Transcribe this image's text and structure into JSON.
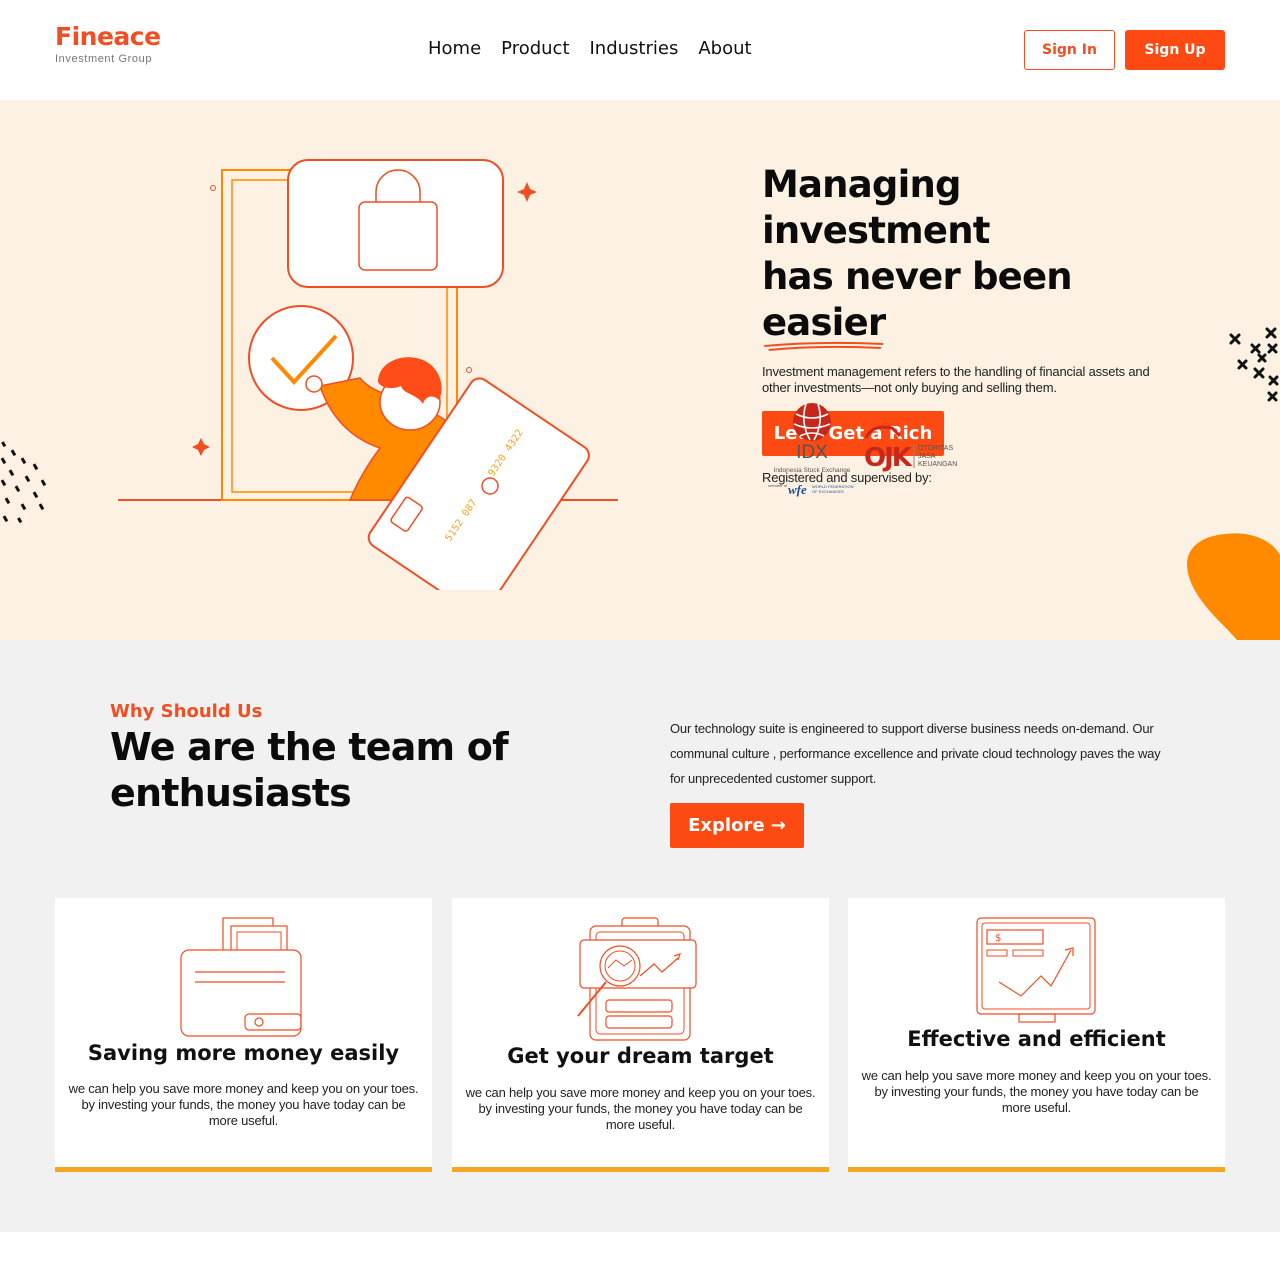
{
  "header": {
    "logo_name": "Fineace",
    "logo_sub": "Investment Group",
    "nav": [
      "Home",
      "Product",
      "Industries",
      "About"
    ],
    "signin_label": "Sign In",
    "signup_label": "Sign Up"
  },
  "hero": {
    "title_line1": "Managing investment",
    "title_line2_prefix": "has never been ",
    "title_highlight": "easier",
    "description": "Investment management refers to the handling of financial assets and other investments—not only buying and selling them.",
    "cta_label": "Let's Get a Rich",
    "registered_label": "Registered and supervised by:",
    "card_number_1": "5152 087",
    "card_number_2": "9320 4322",
    "partners": {
      "idx_name": "IDX",
      "idx_sub": "Indonesia Stock Exchange",
      "wfe_member": "member of",
      "wfe_name": "wfe",
      "wfe_sub1": "WORLD FEDERATION",
      "wfe_sub2": "OF EXCHANGES",
      "ojk_name": "OJK",
      "ojk_line1": "OTORITAS",
      "ojk_line2": "JASA",
      "ojk_line3": "KEUANGAN"
    }
  },
  "why": {
    "eyebrow": "Why Should Us",
    "title": "We are the team of enthusiasts",
    "description": "Our technology suite is engineered to support diverse business needs on-demand. Our communal culture , performance excellence and private cloud technology paves the way for unprecedented customer support.",
    "explore_label": "Explore →",
    "cards": [
      {
        "title": "Saving more money easily",
        "icon": "wallet-icon",
        "description": "we can help you save more money and keep you on your toes. by investing your funds, the money you have today can be more useful."
      },
      {
        "title": "Get your dream target",
        "icon": "target-analysis-icon",
        "description": "we can help you save more money and keep you on your toes. by investing your funds, the money you have today can be more useful."
      },
      {
        "title": "Effective and efficient",
        "icon": "growth-monitor-icon",
        "description": "we can help you save more money and keep you on your toes. by investing your funds, the money you have today can be more useful."
      }
    ]
  },
  "colors": {
    "brand": "#fc4a12",
    "brand_text": "#f04e23",
    "hero_bg": "#fdf1e4",
    "section_bg": "#f1f1f1",
    "card_accent": "#f5a623",
    "illustration_orange": "#ff8a00"
  }
}
